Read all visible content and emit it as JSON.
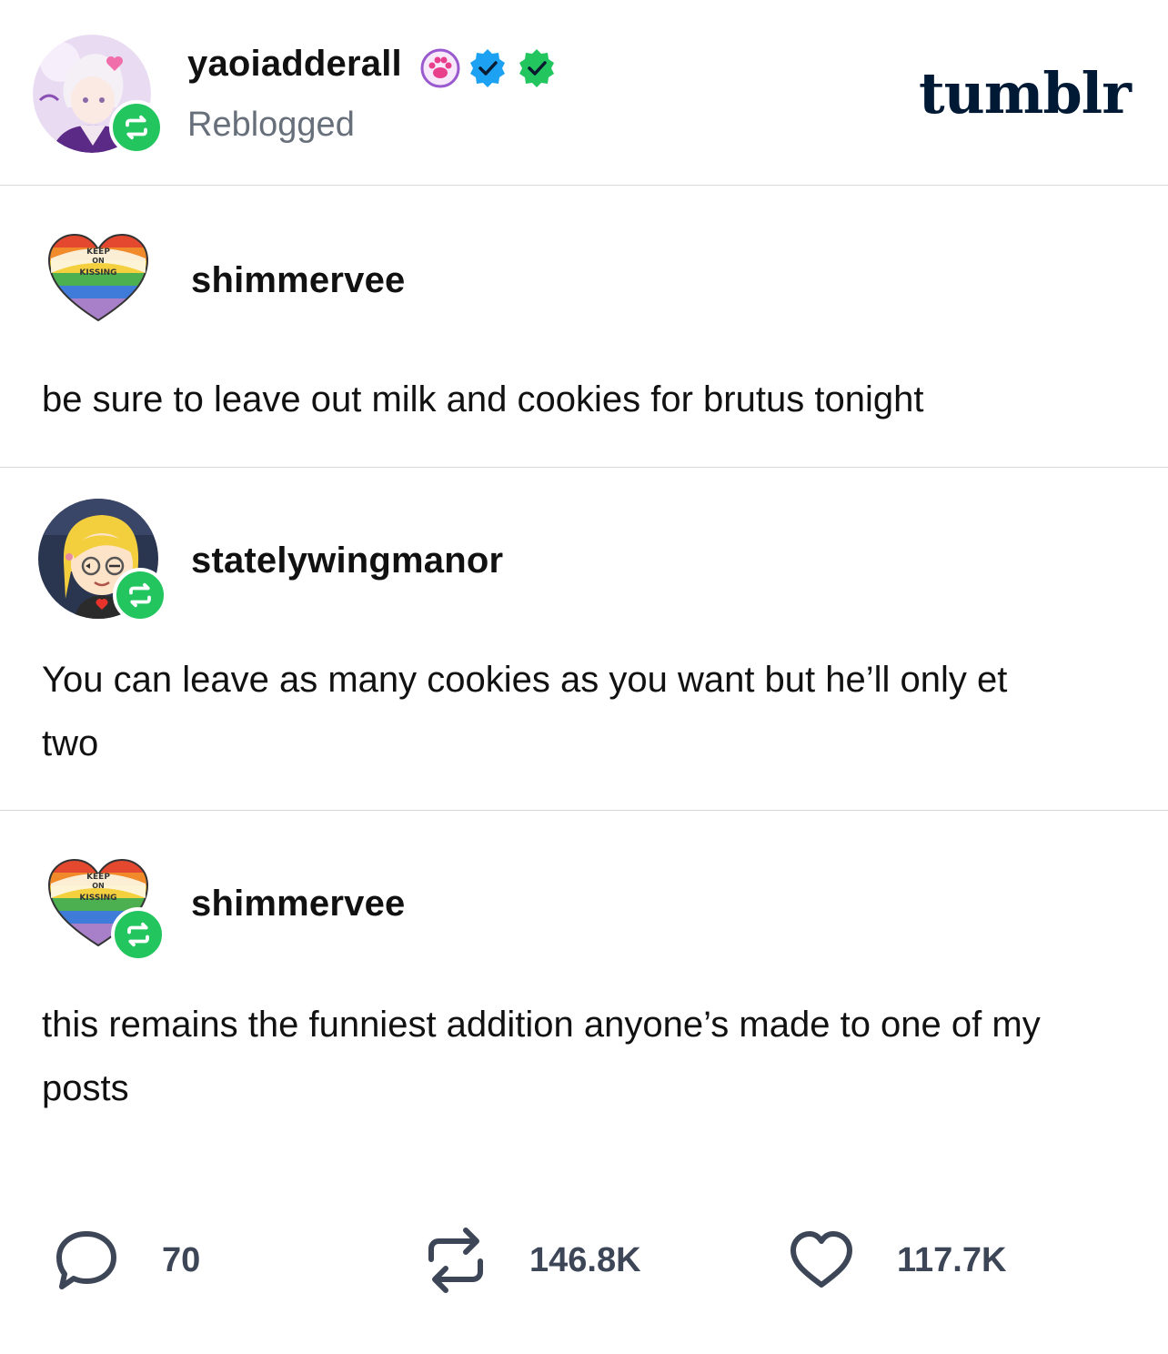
{
  "header": {
    "username": "yaoiadderall",
    "status": "Reblogged",
    "brand": "tumblr"
  },
  "posts": [
    {
      "username": "shimmervee",
      "text": "be sure to leave out milk and cookies for brutus tonight"
    },
    {
      "username": "statelywingmanor",
      "text": "You can leave as many cookies as you want but he’ll only et two"
    },
    {
      "username": "shimmervee",
      "text": "this remains the funniest addition anyone’s made to one of my posts"
    }
  ],
  "footer": {
    "replies": "70",
    "reblogs": "146.8K",
    "likes": "117.7K"
  },
  "heart_avatar": {
    "line1": "KEEP",
    "line2": "ON",
    "line3": "KISSING"
  },
  "icons": {
    "reblog_badge": "reblog-icon",
    "paw_badge": "paw-icon",
    "blue_check": "blue-check-icon",
    "green_check": "green-check-icon",
    "reply": "speech-bubble-icon",
    "reblog": "reblog-icon",
    "like": "heart-icon"
  },
  "colors": {
    "reblog_green": "#22c55e",
    "tumblr_navy": "#001935",
    "blue_check": "#1da1f2",
    "muted_text": "#666f7a"
  }
}
